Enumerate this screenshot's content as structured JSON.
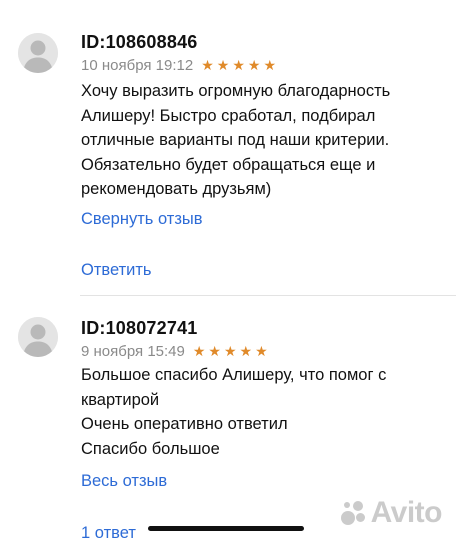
{
  "reviews": [
    {
      "user_id": "ID:108608846",
      "date": "10 ноября 19:12",
      "rating": 5,
      "text": "Хочу выразить огромную благодарность\nАлишеру! Быстро сработал, подбирал\nотличные варианты под наши критерии.\nОбязательно будет обращаться еще и\nрекомендовать друзьям)",
      "collapse_label": "Свернуть отзыв",
      "reply_label": "Ответить"
    },
    {
      "user_id": "ID:108072741",
      "date": "9 ноября 15:49",
      "rating": 5,
      "text": "Большое спасибо Алишеру, что помог с\nквартирой\nОчень оперативно ответил\nСпасибо большое",
      "full_label": "Весь отзыв",
      "answers_label": "1 ответ"
    }
  ],
  "watermark": {
    "text": "Avito"
  },
  "colors": {
    "link": "#2d6bd6",
    "star": "#e08a2a",
    "meta": "#8a8a8a"
  },
  "icons": {
    "avatar": "person-silhouette-icon",
    "star": "star-icon"
  }
}
